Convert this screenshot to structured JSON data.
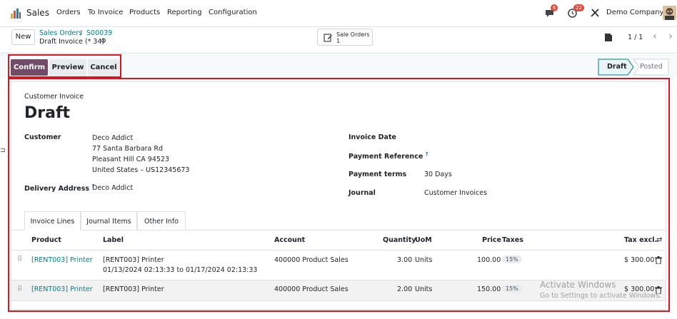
{
  "navbar": {
    "app_name": "Sales",
    "menu": [
      "Orders",
      "To Invoice",
      "Products",
      "Reporting",
      "Configuration"
    ],
    "messages_count": "6",
    "activities_count": "22",
    "company": "Demo Company"
  },
  "control_panel": {
    "new_label": "New",
    "breadcrumb_parent": "Sales Orders",
    "breadcrumb_sep": "/",
    "breadcrumb_order": "S00039",
    "breadcrumb_current": "Draft Invoice (* 34)",
    "smart_button_label": "Sale Orders",
    "smart_button_count": "1",
    "pager": "1 / 1"
  },
  "actions": {
    "confirm": "Confirm",
    "preview": "Preview",
    "cancel": "Cancel"
  },
  "status": {
    "draft": "Draft",
    "posted": "Posted"
  },
  "form": {
    "move_type": "Customer Invoice",
    "state_title": "Draft",
    "customer_label": "Customer",
    "customer_name": "Deco Addict",
    "customer_address_1": "77 Santa Barbara Rd",
    "customer_address_2": "Pleasant Hill CA 94523",
    "customer_address_3": "United States – US12345673",
    "delivery_label": "Delivery Address",
    "delivery_help": "?",
    "delivery_value": "Deco Addict",
    "invoice_date_label": "Invoice Date",
    "payment_ref_label": "Payment Reference",
    "payment_ref_help": "?",
    "payment_terms_label": "Payment terms",
    "payment_terms_value": "30 Days",
    "journal_label": "Journal",
    "journal_value": "Customer Invoices"
  },
  "tabs": [
    "Invoice Lines",
    "Journal Items",
    "Other Info"
  ],
  "lines": {
    "headers": {
      "product": "Product",
      "label": "Label",
      "account": "Account",
      "quantity": "Quantity",
      "uom": "UoM",
      "price": "Price",
      "taxes": "Taxes",
      "tax_excl": "Tax excl."
    },
    "rows": [
      {
        "product": "[RENT003] Printer",
        "label_1": "[RENT003] Printer",
        "label_2": "01/13/2024 02:13:33 to 01/17/2024 02:13:33",
        "account": "400000 Product Sales",
        "quantity": "3.00",
        "uom": "Units",
        "price": "100.00",
        "tax": "15%",
        "subtotal": "$ 300.00"
      },
      {
        "product": "[RENT003] Printer",
        "label_1": "[RENT003] Printer",
        "label_2": "",
        "account": "400000 Product Sales",
        "quantity": "2.00",
        "uom": "Units",
        "price": "150.00",
        "tax": "15%",
        "subtotal": "$ 300.00"
      }
    ]
  },
  "watermark": {
    "line1": "Activate Windows",
    "line2": "Go to Settings to activate Windows."
  },
  "colors": {
    "primary": "#714b67",
    "link": "#017e84",
    "highlight_box": "#e0121e"
  }
}
